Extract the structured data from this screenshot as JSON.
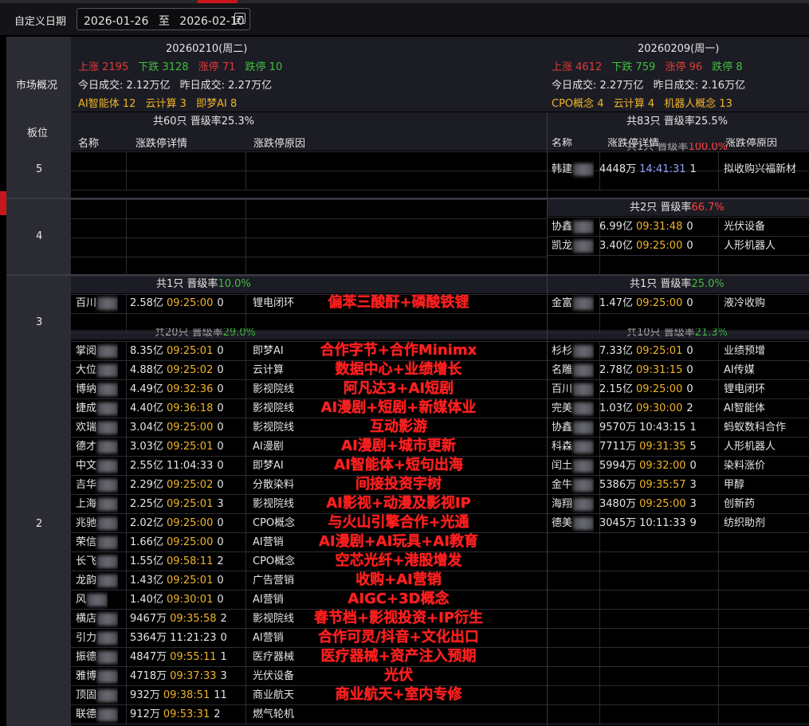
{
  "toolbar": {
    "label": "自定义日期",
    "start": "2026-01-26",
    "sep": "至",
    "end": "2026-02-10"
  },
  "left_header": {
    "date": "20260210(周二)"
  },
  "right_header": {
    "date": "20260209(周一)"
  },
  "market": {
    "label": "市场概况",
    "left": {
      "up": "上涨 2195",
      "down": "下跌 3128",
      "limitup": "涨停 71",
      "limitdown": "跌停 10",
      "vol_today": "今日成交: 2.12万亿",
      "vol_yest": "昨日成交: 2.27万亿",
      "hot1": "AI智能体 12",
      "hot2": "云计算 3",
      "hot3": "即梦AI 8"
    },
    "right": {
      "up": "上涨 4612",
      "down": "下跌 759",
      "limitup": "涨停 96",
      "limitdown": "跌停 8",
      "vol_today": "今日成交: 2.27万亿",
      "vol_yest": "昨日成交: 2.16万亿",
      "hot1": "CPO概念 4",
      "hot2": "云计算 4",
      "hot3": "机器人概念 13"
    }
  },
  "board_label": "板位",
  "summary": {
    "left": {
      "count": "共60只",
      "rate_label": "晋级率",
      "rate": "25.3%"
    },
    "right": {
      "count": "共83只",
      "rate_label": "晋级率",
      "rate": "25.5%"
    }
  },
  "columns": {
    "name": "名称",
    "detail": "涨跌停详情",
    "reason": "涨跌停原因"
  },
  "levels": {
    "l5": "5",
    "l4": "4",
    "l3": "3",
    "l2": "2"
  },
  "sec5_right": {
    "count": "共1只",
    "rate_label": "晋级率",
    "rate": "100.0%"
  },
  "sec4_right": {
    "count": "共2只",
    "rate_label": "晋级率",
    "rate": "66.7%"
  },
  "sec3_left": {
    "count": "共1只",
    "rate_label": "晋级率",
    "rate": "10.0%"
  },
  "sec3_right": {
    "count": "共1只",
    "rate_label": "晋级率",
    "rate": "25.0%"
  },
  "sec2_left": {
    "count": "共20只",
    "rate_label": "晋级率",
    "rate": "29.0%"
  },
  "sec2_right": {
    "count": "共10只",
    "rate_label": "晋级率",
    "rate": "21.3%"
  },
  "right5": [
    {
      "name": "韩建",
      "amt": "4448万",
      "time": "14:41:31",
      "n": "1",
      "reason": "拟收购兴福新材"
    }
  ],
  "right4": [
    {
      "name": "协鑫",
      "amt": "6.99亿",
      "time": "09:31:48",
      "n": "0",
      "reason": "光伏设备"
    },
    {
      "name": "凯龙",
      "amt": "3.40亿",
      "time": "09:25:00",
      "n": "0",
      "reason": "人形机器人"
    }
  ],
  "left3": [
    {
      "name": "百川",
      "amt": "2.58亿",
      "time": "09:25:00",
      "n": "0",
      "reason": "锂电闭环",
      "anno": "偏苯三酸酐+磷酸铁锂"
    }
  ],
  "right3": [
    {
      "name": "金富",
      "amt": "1.47亿",
      "time": "09:25:00",
      "n": "0",
      "reason": "液冷收购"
    }
  ],
  "left2": [
    {
      "name": "掌阅",
      "amt": "8.35亿",
      "time": "09:25:01",
      "n": "0",
      "reason": "即梦AI",
      "anno": "合作字节+合作Minimx"
    },
    {
      "name": "大位",
      "amt": "4.88亿",
      "time": "09:25:02",
      "n": "0",
      "reason": "云计算",
      "anno": "数据中心+业绩增长"
    },
    {
      "name": "博纳",
      "amt": "4.49亿",
      "time": "09:32:36",
      "n": "0",
      "reason": "影视院线",
      "anno": "阿凡达3+AI短剧"
    },
    {
      "name": "捷成",
      "amt": "4.40亿",
      "time": "09:36:18",
      "n": "0",
      "reason": "影视院线",
      "anno": "AI漫剧+短剧+新媒体业"
    },
    {
      "name": "欢瑞",
      "amt": "3.04亿",
      "time": "09:25:00",
      "n": "0",
      "reason": "影视院线",
      "anno": "互动影游"
    },
    {
      "name": "德才",
      "amt": "3.03亿",
      "time": "09:25:01",
      "n": "0",
      "reason": "AI漫剧",
      "anno": "AI漫剧+城市更新"
    },
    {
      "name": "中文",
      "amt": "2.55亿",
      "time": "11:04:33",
      "n": "0",
      "reason": "即梦AI",
      "anno": "AI智能体+短句出海"
    },
    {
      "name": "吉华",
      "amt": "2.29亿",
      "time": "09:25:02",
      "n": "0",
      "reason": "分散染料",
      "anno": "间接投资宇树"
    },
    {
      "name": "上海",
      "amt": "2.25亿",
      "time": "09:25:01",
      "n": "3",
      "reason": "影视院线",
      "anno": "AI影视+动漫及影视IP"
    },
    {
      "name": "兆驰",
      "amt": "2.02亿",
      "time": "09:25:00",
      "n": "0",
      "reason": "CPO概念",
      "anno": "与火山引擎合作+光通"
    },
    {
      "name": "荣信",
      "amt": "1.66亿",
      "time": "09:25:00",
      "n": "0",
      "reason": "AI营销",
      "anno": "AI漫剧+AI玩具+AI教育"
    },
    {
      "name": "长飞",
      "amt": "1.55亿",
      "time": "09:58:11",
      "n": "2",
      "reason": "CPO概念",
      "anno": "空芯光纤+港股增发"
    },
    {
      "name": "龙韵",
      "amt": "1.43亿",
      "time": "09:25:01",
      "n": "0",
      "reason": "广告营销",
      "anno": "收购+AI营销"
    },
    {
      "name": "风",
      "amt": "1.40亿",
      "time": "09:30:01",
      "n": "0",
      "reason": "AI营销",
      "anno": "AIGC+3D概念"
    },
    {
      "name": "横店",
      "amt": "9467万",
      "time": "09:35:58",
      "n": "2",
      "reason": "影视院线",
      "anno": "春节档+影视投资+IP衍生"
    },
    {
      "name": "引力",
      "amt": "5364万",
      "time": "11:21:23",
      "n": "0",
      "reason": "AI营销",
      "anno": "合作可灵/抖音+文化出口"
    },
    {
      "name": "振德",
      "amt": "4847万",
      "time": "09:55:11",
      "n": "1",
      "reason": "医疗器械",
      "anno": "医疗器械+资产注入预期"
    },
    {
      "name": "雅博",
      "amt": "4718万",
      "time": "09:37:33",
      "n": "3",
      "reason": "光伏设备",
      "anno": "光伏"
    },
    {
      "name": "顶固",
      "amt": "932万",
      "time": "09:38:51",
      "n": "11",
      "reason": "商业航天",
      "anno": "商业航天+室内专修"
    },
    {
      "name": "联德",
      "amt": "912万",
      "time": "09:53:31",
      "n": "2",
      "reason": "燃气轮机",
      "anno": ""
    }
  ],
  "right2": [
    {
      "name": "杉杉",
      "amt": "7.33亿",
      "time": "09:25:01",
      "n": "0",
      "reason": "业绩预增"
    },
    {
      "name": "名雕",
      "amt": "2.78亿",
      "time": "09:31:15",
      "n": "0",
      "reason": "AI传媒"
    },
    {
      "name": "百川",
      "amt": "2.15亿",
      "time": "09:25:00",
      "n": "0",
      "reason": "锂电闭环"
    },
    {
      "name": "完美",
      "amt": "1.03亿",
      "time": "09:30:00",
      "n": "2",
      "reason": "AI智能体"
    },
    {
      "name": "协鑫",
      "amt": "9570万",
      "time": "10:43:15",
      "n": "1",
      "reason": "蚂蚁数科合作"
    },
    {
      "name": "科森",
      "amt": "7711万",
      "time": "09:31:35",
      "n": "5",
      "reason": "人形机器人"
    },
    {
      "name": "闰土",
      "amt": "5994万",
      "time": "09:32:00",
      "n": "0",
      "reason": "染料涨价"
    },
    {
      "name": "金牛",
      "amt": "5386万",
      "time": "09:35:57",
      "n": "3",
      "reason": "甲醇"
    },
    {
      "name": "海翔",
      "amt": "3480万",
      "time": "09:25:00",
      "n": "3",
      "reason": "创新药"
    },
    {
      "name": "德美",
      "amt": "3045万",
      "time": "10:11:33",
      "n": "9",
      "reason": "纺织助剂"
    }
  ]
}
